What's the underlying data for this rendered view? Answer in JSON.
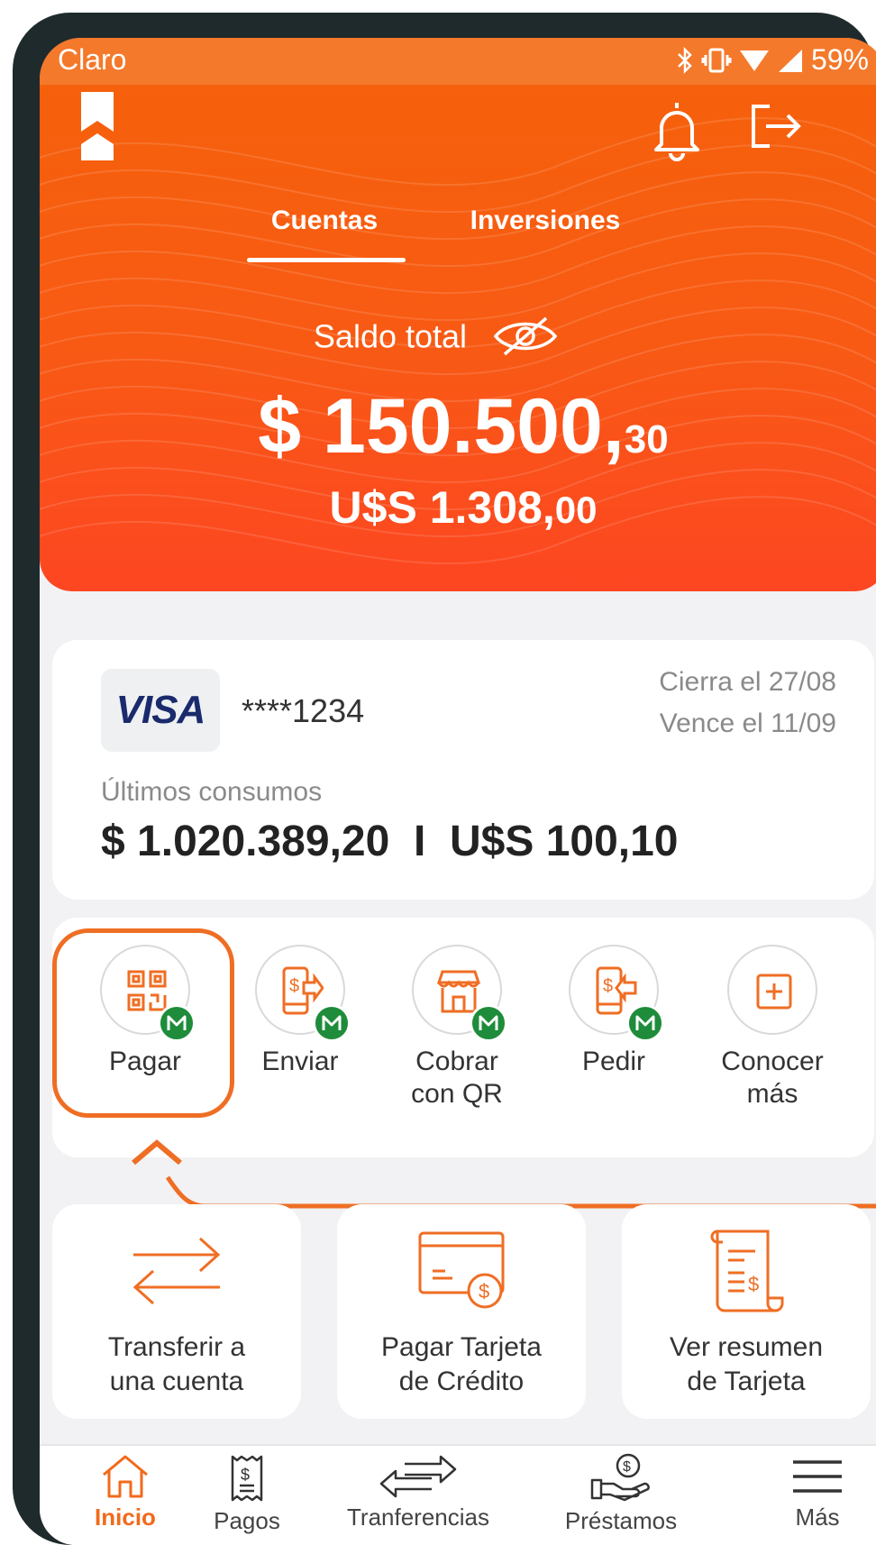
{
  "status_bar": {
    "carrier": "Claro",
    "battery": "59%"
  },
  "header": {
    "tabs": [
      {
        "label": "Cuentas",
        "active": true
      },
      {
        "label": "Inversiones",
        "active": false
      }
    ],
    "balance_label": "Saldo total",
    "balance_ars_int": "$ 150.500,",
    "balance_ars_dec": "30",
    "balance_usd_int": "U$S 1.308,",
    "balance_usd_dec": "00"
  },
  "card": {
    "brand": "VISA",
    "number": "****1234",
    "closes": "Cierra el 27/08",
    "due": "Vence el 11/09",
    "recent_label": "Últimos consumos",
    "recent_amounts": "$ 1.020.389,20  I  U$S 100,10"
  },
  "actions": [
    {
      "label1": "Pagar",
      "label2": "",
      "icon": "qr-code-icon",
      "badge": true
    },
    {
      "label1": "Enviar",
      "label2": "",
      "icon": "phone-send-money-icon",
      "badge": true
    },
    {
      "label1": "Cobrar",
      "label2": "con QR",
      "icon": "store-icon",
      "badge": true
    },
    {
      "label1": "Pedir",
      "label2": "",
      "icon": "phone-request-money-icon",
      "badge": true
    },
    {
      "label1": "Conocer",
      "label2": "más",
      "icon": "plus-icon",
      "badge": false
    }
  ],
  "quick_actions": [
    {
      "label1": "Transferir a",
      "label2": "una cuenta",
      "icon": "transfer-arrows-icon"
    },
    {
      "label1": "Pagar Tarjeta",
      "label2": "de Crédito",
      "icon": "credit-card-pay-icon"
    },
    {
      "label1": "Ver resumen",
      "label2": "de Tarjeta",
      "icon": "receipt-icon"
    }
  ],
  "bottom_nav": [
    {
      "label": "Inicio",
      "icon": "home-icon",
      "active": true
    },
    {
      "label": "Pagos",
      "icon": "bill-icon",
      "active": false
    },
    {
      "label": "Tranferencias",
      "icon": "transfer-icon",
      "active": false
    },
    {
      "label": "Préstamos",
      "icon": "loan-hand-icon",
      "active": false
    },
    {
      "label": "Más",
      "icon": "menu-icon",
      "active": false
    }
  ],
  "colors": {
    "brand_orange": "#f5620a",
    "accent_orange": "#ef6e24",
    "badge_green": "#1e8c3a"
  }
}
